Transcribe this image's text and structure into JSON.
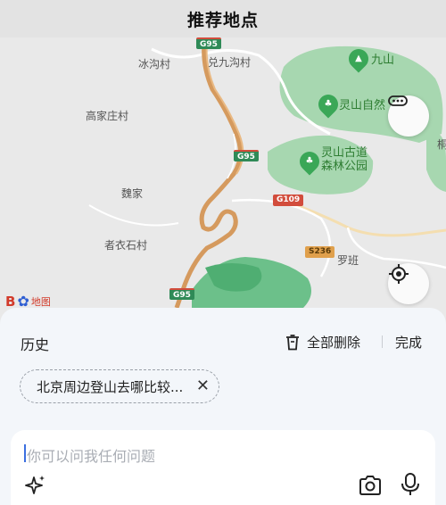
{
  "header": {
    "title": "推荐地点"
  },
  "map": {
    "place_labels": [
      "冰沟村",
      "兑九沟村",
      "高家庄村",
      "魏家",
      "者衣石村",
      "罗班",
      "桐"
    ],
    "poi_labels": [
      {
        "name": "九山",
        "icon": "mountain-icon"
      },
      {
        "name": "灵山自然",
        "icon": "tree-icon"
      },
      {
        "name": "灵山古道森林公园",
        "icon": "tree-icon"
      }
    ],
    "road_badges": [
      "G95",
      "G95",
      "G109",
      "S236",
      "G95"
    ],
    "logo_text": "地图",
    "buttons": {
      "more": "more-dots-icon",
      "locate": "locate-icon"
    }
  },
  "sheet": {
    "history_title": "历史",
    "clear_all_label": "全部删除",
    "done_label": "完成",
    "history_items": [
      "北京周边登山去哪比较..."
    ]
  },
  "input": {
    "placeholder": "你可以问我任何问题",
    "icons": [
      "sparkle-icon",
      "camera-icon",
      "microphone-icon"
    ]
  },
  "colors": {
    "forest": "#7cc68f",
    "forest_dark": "#3aa757",
    "highway": "#d9a36a",
    "accent_cursor": "#3b6fe0"
  }
}
